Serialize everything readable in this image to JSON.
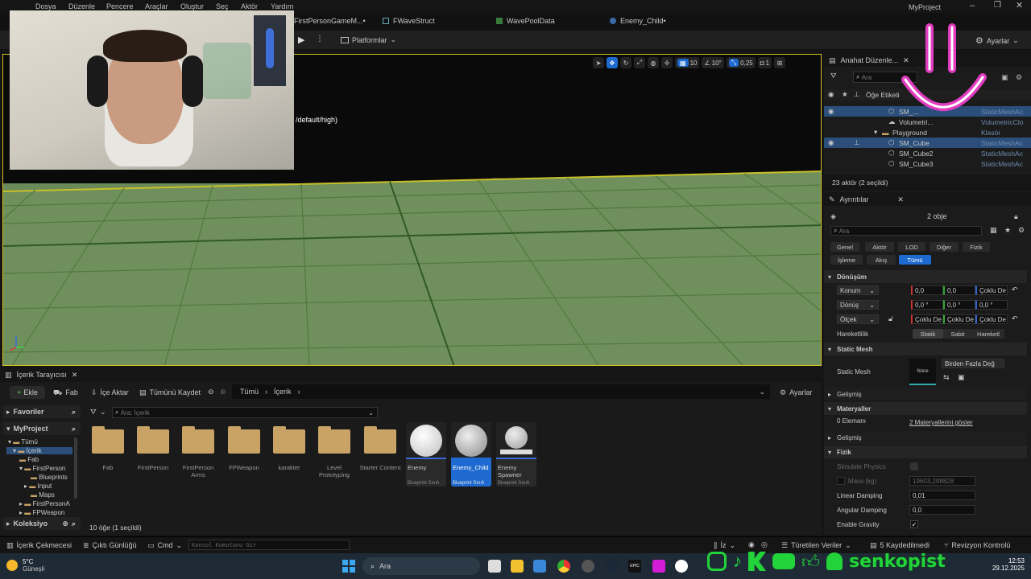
{
  "menubar": {
    "items": [
      "Dosya",
      "Düzenle",
      "Pencere",
      "Araçlar",
      "Oluştur",
      "Seç",
      "Aktör",
      "Yardım"
    ],
    "project": "MyProject"
  },
  "doc_tabs": [
    "FirstPersonGameM...•",
    "FWaveStruct",
    "WavePoolData",
    "Enemy_Child•"
  ],
  "toolbar": {
    "platforms": "Platformlar",
    "settings": "Ayarlar"
  },
  "viewport": {
    "overlay_text": "/default/high)",
    "tools": {
      "grid": "10",
      "angle": "10°",
      "scale": "0,25",
      "camera": "1"
    }
  },
  "outliner": {
    "title": "Anahat Düzenle...",
    "search_placeholder": "Ara",
    "col_label": "Öğe Etiketi",
    "rows": [
      {
        "name": "SM_...",
        "type": "StaticMeshAc"
      },
      {
        "name": "Volumetri...",
        "type": "VolumetricClo"
      },
      {
        "name": "Playground",
        "type": "Klasör"
      },
      {
        "name": "SM_Cube",
        "type": "StaticMeshAc"
      },
      {
        "name": "SM_Cube2",
        "type": "StaticMeshAc"
      },
      {
        "name": "SM_Cube3",
        "type": "StaticMeshAc"
      }
    ],
    "footer": "23 aktör (2 seçildi)"
  },
  "details": {
    "title": "Ayrıntılar",
    "count": "2 obje",
    "search_placeholder": "Ara",
    "filters": [
      "Genel",
      "Aktör",
      "LOD",
      "Diğer",
      "Fizik",
      "İşleme",
      "Akış",
      "Tümü"
    ],
    "sections": {
      "transform": "Dönüşüm",
      "static_mesh": "Static Mesh",
      "advanced": "Gelişmiş",
      "materials": "Materyaller",
      "advanced2": "Gelişmiş",
      "physics": "Fizik"
    },
    "transform": {
      "location_label": "Konum",
      "rotation_label": "Dönüş",
      "scale_label": "Ölçek",
      "loc": [
        "0,0",
        "0,0",
        "Çoklu De"
      ],
      "rot": [
        "0,0 °",
        "0,0 °",
        "0,0 °"
      ],
      "scale": [
        "Çoklu De",
        "Çoklu De",
        "Çoklu De"
      ],
      "mobility_label": "Hareketlilik",
      "mobility": [
        "Statik",
        "Sabit",
        "Hareketl"
      ]
    },
    "static_mesh": {
      "label": "Static Mesh",
      "value": "Birden Fazla Değ",
      "thumb": "None"
    },
    "materials": {
      "label": "0 Elemanı",
      "link": "2 Materyallerini göster"
    },
    "physics": [
      {
        "label": "Simulate Physics",
        "value": ""
      },
      {
        "label": "Mass (kg)",
        "value": "19603,298828"
      },
      {
        "label": "Linear Damping",
        "value": "0,01"
      },
      {
        "label": "Angular Damping",
        "value": "0,0"
      },
      {
        "label": "Enable Gravity",
        "value": ""
      }
    ]
  },
  "content_browser": {
    "tab": "İçerik Tarayıcısı",
    "add": "Ekle",
    "fab": "Fab",
    "import": "İçe Aktar",
    "save_all": "Tümünü Kaydet",
    "path": [
      "Tümü",
      "İçerik"
    ],
    "settings": "Ayarlar",
    "favorites": "Favoriler",
    "project": "MyProject",
    "search_placeholder": "Ara: İçerik",
    "tree": [
      "Tümü",
      "İçerik",
      "Fab",
      "FirstPerson",
      "Blueprints",
      "Input",
      "Maps",
      "FirstPersonA",
      "FPWeapon"
    ],
    "collections": "Koleksiyo",
    "folders": [
      "Fab",
      "FirstPerson",
      "FirstPerson Arms",
      "FPWeapon",
      "karakter",
      "Level Prototyping",
      "Starter Content"
    ],
    "assets": [
      {
        "name": "Enemy",
        "class": "Blueprint Sınıfı"
      },
      {
        "name": "Enemy_Child",
        "class": "Blueprint Sınıfı"
      },
      {
        "name": "Enemy Spawner",
        "class": "Blueprint Sınıfı"
      }
    ],
    "footer": "10 öğe (1 seçildi)"
  },
  "statusbar": {
    "content_drawer": "İçerik Çekmecesi",
    "output_log": "Çıktı Günlüğü",
    "cmd": "Cmd",
    "console_placeholder": "Konsol Komutunu Gir",
    "trace": "İz",
    "derived": "Türetilen Veriler",
    "saved": "5 Kaydedilmedi",
    "revision": "Revizyon Kontrolü"
  },
  "taskbar": {
    "weather_temp": "5°C",
    "weather_desc": "Güneşli",
    "search": "Ara",
    "time": "12:53",
    "date": "29.12.2025"
  },
  "overlay": {
    "handle": "senkopist"
  },
  "colors": {
    "accent": "#1f6ad0",
    "selection": "#d6c21e",
    "folder": "#c9a366"
  }
}
